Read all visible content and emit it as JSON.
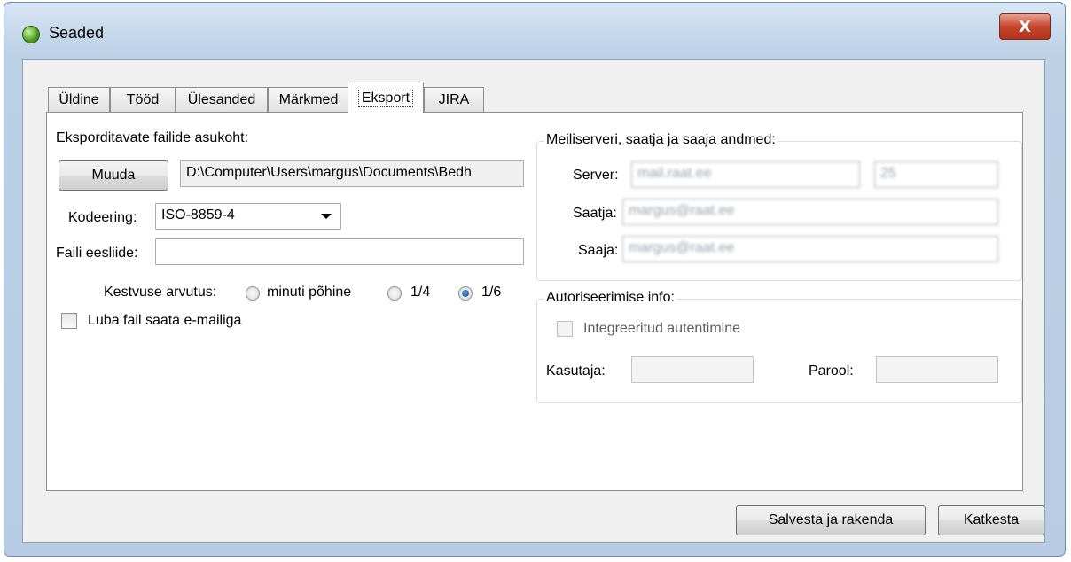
{
  "window": {
    "title": "Seaded",
    "close_symbol": "X",
    "app_icon": "app-orb-icon",
    "close_icon": "close-icon"
  },
  "tabs": [
    {
      "label": "Üldine",
      "active": false
    },
    {
      "label": "Tööd",
      "active": false
    },
    {
      "label": "Ülesanded",
      "active": false
    },
    {
      "label": "Märkmed",
      "active": false
    },
    {
      "label": "Eksport",
      "active": true
    },
    {
      "label": "JIRA",
      "active": false
    }
  ],
  "export": {
    "location_label": "Eksporditavate failide asukoht:",
    "change_button": "Muuda",
    "path_value": "D:\\Computer\\Users\\margus\\Documents\\Bedh",
    "encoding_label": "Kodeering:",
    "encoding_value": "ISO-8859-4",
    "prefix_label": "Faili eesliide:",
    "prefix_value": "",
    "duration_label": "Kestvuse arvutus:",
    "duration_options": [
      {
        "label": "minuti põhine",
        "checked": false
      },
      {
        "label": "1/4",
        "checked": false
      },
      {
        "label": "1/6",
        "checked": true
      }
    ],
    "email_checkbox_label": "Luba fail saata e-mailiga",
    "email_checkbox_checked": false
  },
  "mail": {
    "group_title": "Meiliserveri, saatja ja saaja andmed:",
    "server_label": "Server:",
    "server_value": "mail.raat.ee",
    "port_value": "25",
    "sender_label": "Saatja:",
    "sender_value": "margus@raat.ee",
    "receiver_label": "Saaja:",
    "receiver_value": "margus@raat.ee"
  },
  "auth": {
    "group_title": "Autoriseerimise info:",
    "integrated_label": "Integreeritud autentimine",
    "integrated_checked": false,
    "user_label": "Kasutaja:",
    "user_value": "",
    "password_label": "Parool:",
    "password_value": ""
  },
  "footer": {
    "save_button": "Salvesta ja rakenda",
    "cancel_button": "Katkesta"
  }
}
